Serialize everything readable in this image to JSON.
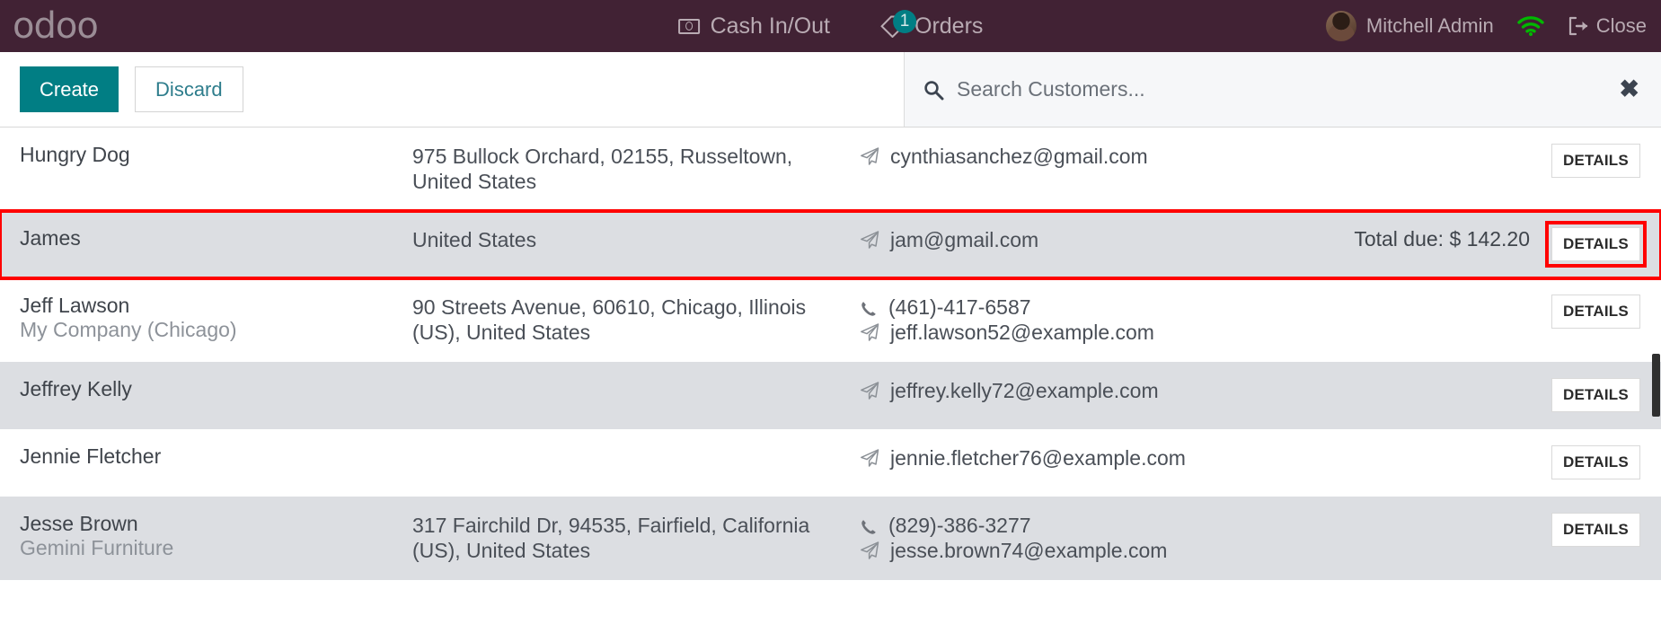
{
  "navbar": {
    "brand": "odoo",
    "cash_label": "Cash In/Out",
    "orders_label": "Orders",
    "orders_badge": "1",
    "user_name": "Mitchell Admin",
    "close_label": "Close",
    "bg_color": "#412234",
    "accent_color": "#017e84"
  },
  "toolbar": {
    "create_label": "Create",
    "discard_label": "Discard",
    "search_placeholder": "Search Customers...",
    "search_value": "",
    "clear_label": "✖"
  },
  "list": {
    "details_label": "DETAILS",
    "highlight_color": "#ff0000",
    "rows": [
      {
        "name": "Hungry Dog",
        "company": "",
        "address": "975 Bullock Orchard, 02155, Russeltown, United States",
        "phone": "",
        "email": "cynthiasanchez@gmail.com",
        "due": "",
        "selected": false
      },
      {
        "name": "James",
        "company": "",
        "address": "United States",
        "phone": "",
        "email": "jam@gmail.com",
        "due": "Total due: $ 142.20",
        "selected": true
      },
      {
        "name": "Jeff Lawson",
        "company": "My Company (Chicago)",
        "address": "90 Streets Avenue, 60610, Chicago, Illinois (US), United States",
        "phone": "(461)-417-6587",
        "email": "jeff.lawson52@example.com",
        "due": "",
        "selected": false
      },
      {
        "name": "Jeffrey Kelly",
        "company": "",
        "address": "",
        "phone": "",
        "email": "jeffrey.kelly72@example.com",
        "due": "",
        "selected": false
      },
      {
        "name": "Jennie Fletcher",
        "company": "",
        "address": "",
        "phone": "",
        "email": "jennie.fletcher76@example.com",
        "due": "",
        "selected": false
      },
      {
        "name": "Jesse Brown",
        "company": "Gemini Furniture",
        "address": "317 Fairchild Dr, 94535, Fairfield, California (US), United States",
        "phone": "(829)-386-3277",
        "email": "jesse.brown74@example.com",
        "due": "",
        "selected": false
      }
    ]
  }
}
